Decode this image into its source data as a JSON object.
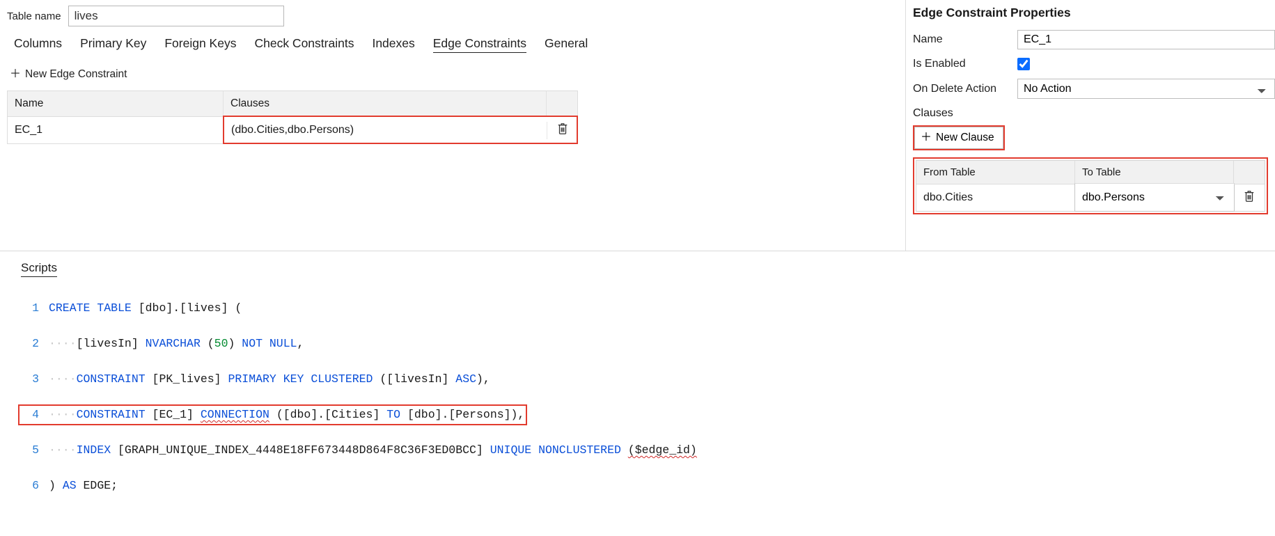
{
  "tablename": {
    "label": "Table name",
    "value": "lives"
  },
  "tabs": {
    "columns": "Columns",
    "primary_key": "Primary Key",
    "foreign_keys": "Foreign Keys",
    "check_constraints": "Check Constraints",
    "indexes": "Indexes",
    "edge_constraints": "Edge Constraints",
    "general": "General"
  },
  "buttons": {
    "new_edge_constraint": "New Edge Constraint",
    "new_clause": "New Clause"
  },
  "ec_grid": {
    "headers": {
      "name": "Name",
      "clauses": "Clauses"
    },
    "row": {
      "name": "EC_1",
      "clauses": "(dbo.Cities,dbo.Persons)"
    }
  },
  "props": {
    "title": "Edge Constraint Properties",
    "name_label": "Name",
    "name_value": "EC_1",
    "enabled_label": "Is Enabled",
    "enabled_value": true,
    "ondelete_label": "On Delete Action",
    "ondelete_value": "No Action",
    "clauses_label": "Clauses"
  },
  "clause_grid": {
    "headers": {
      "from": "From Table",
      "to": "To Table"
    },
    "row": {
      "from": "dbo.Cities",
      "to": "dbo.Persons"
    }
  },
  "scripts": {
    "title": "Scripts",
    "lines": [
      {
        "n": "1"
      },
      {
        "n": "2"
      },
      {
        "n": "3"
      },
      {
        "n": "4"
      },
      {
        "n": "5"
      },
      {
        "n": "6"
      }
    ],
    "t": {
      "create": "CREATE",
      "table": "TABLE",
      "dbo_lives": "[dbo].[lives]",
      "op": "(",
      "livesIn": "[livesIn]",
      "nvarchar": "NVARCHAR",
      "fifty": "50",
      "notnull": "NOT NULL",
      "comma": ",",
      "constraint": "CONSTRAINT",
      "pk": "[PK_lives]",
      "primary": "PRIMARY",
      "key": "KEY",
      "clustered": "CLUSTERED",
      "livesin2": "([livesIn]",
      "asc": "ASC",
      "cp": "),",
      "ec": "[EC_1]",
      "connection": "CONNECTION",
      "conn_open": "(",
      "dbo": "[dbo]",
      "dot": ".",
      "cities": "[Cities]",
      "to": "TO",
      "persons": "[Persons]",
      "cp2": "),",
      "index": "INDEX",
      "idxname": "[GRAPH_UNIQUE_INDEX_4448E18FF673448D864F8C36F3ED0BCC]",
      "unique": "UNIQUE",
      "nonclustered": "NONCLUSTERED",
      "edgeid": "($edge_id)",
      "close": ")",
      "as": "AS",
      "edge": "EDGE;"
    }
  }
}
